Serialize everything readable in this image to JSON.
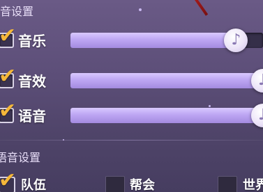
{
  "sound_settings": {
    "title": "声音设置",
    "music": {
      "label": "音乐",
      "checked": true,
      "volume": 0.86
    },
    "sfx": {
      "label": "音效",
      "checked": true,
      "volume": 1.0
    },
    "voice": {
      "label": "语音",
      "checked": true,
      "volume": 1.0
    }
  },
  "voice_settings": {
    "title": "语音设置",
    "channels": [
      {
        "label": "队伍",
        "checked": true
      },
      {
        "label": "帮会",
        "checked": false
      },
      {
        "label": "世界",
        "checked": false
      }
    ]
  },
  "icons": {
    "check": "checkmark-icon",
    "knob": "music-note-icon"
  },
  "colors": {
    "check": "#f5b73a",
    "slider_fill": "#bda6f3",
    "background": "#5c4e78"
  }
}
